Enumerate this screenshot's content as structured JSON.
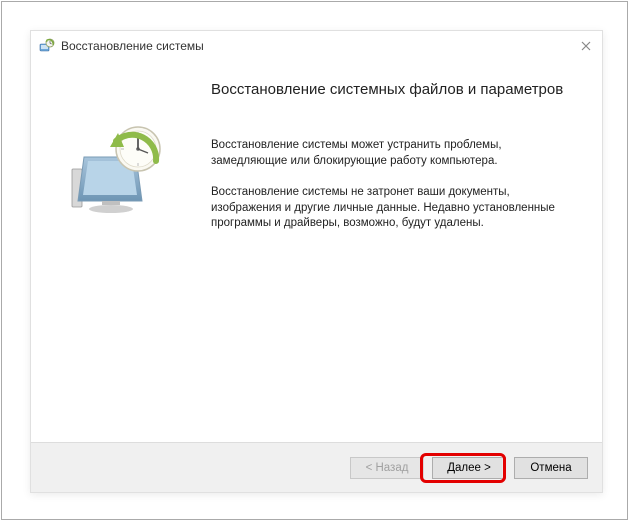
{
  "window": {
    "title": "Восстановление системы"
  },
  "main": {
    "heading": "Восстановление системных файлов и параметров",
    "paragraph1": "Восстановление системы может устранить проблемы, замедляющие или блокирующие работу компьютера.",
    "paragraph2": "Восстановление системы не затронет ваши документы, изображения и другие личные данные. Недавно установленные программы и драйверы, возможно, будут удалены."
  },
  "footer": {
    "back_label": "< Назад",
    "next_label": "Далее >",
    "cancel_label": "Отмена"
  },
  "icons": {
    "title_icon": "system-restore-icon",
    "main_icon": "computer-clock-restore-icon"
  }
}
